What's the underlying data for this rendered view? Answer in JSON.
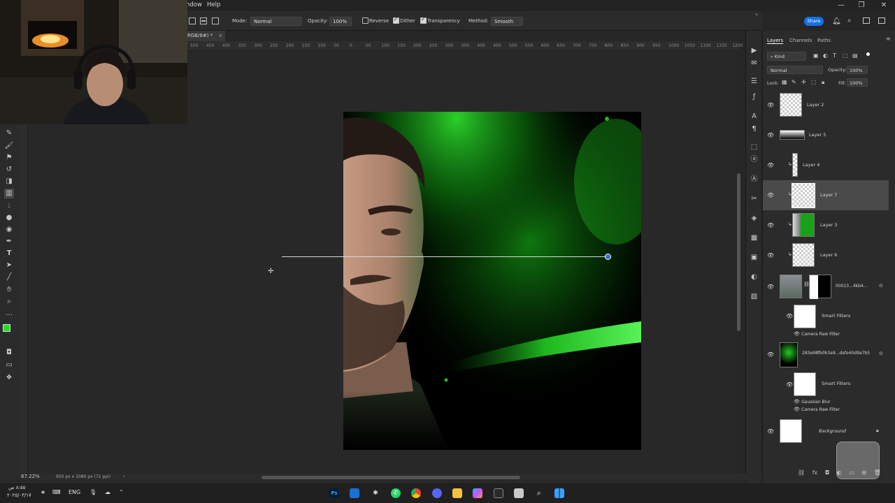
{
  "menu": {
    "window": "ndow",
    "help": "Help"
  },
  "window_controls": {
    "minimize": "—",
    "restore": "❐",
    "close": "✕"
  },
  "options": {
    "mode_label": "Mode:",
    "mode_value": "Normal",
    "opacity_label": "Opacity:",
    "opacity_value": "100%",
    "reverse_label": "Reverse",
    "dither_label": "Dither",
    "transparency_label": "Transparency",
    "method_label": "Method:",
    "method_value": "Smooth",
    "share_label": "Share"
  },
  "document_tab": {
    "title": "RGB/8#) *",
    "close": "×"
  },
  "ruler_ticks": [
    "500",
    "450",
    "400",
    "350",
    "300",
    "250",
    "200",
    "150",
    "100",
    "50",
    "0",
    "50",
    "100",
    "150",
    "200",
    "250",
    "300",
    "350",
    "400",
    "450",
    "500",
    "550",
    "600",
    "650",
    "700",
    "750",
    "800",
    "850",
    "900",
    "950",
    "1000",
    "1050",
    "1100",
    "1150",
    "1200",
    "1250"
  ],
  "status": {
    "zoom": "67.22%",
    "doc_info": "950 px x 1080 px (72 ppi)",
    "arrow": "›"
  },
  "panel": {
    "tabs": [
      "Layers",
      "Channels",
      "Paths"
    ],
    "filter_label": "Kind",
    "blend_mode": "Normal",
    "opacity_label": "Opacity:",
    "opacity_value": "100%",
    "lock_label": "Lock:",
    "fill_label": "Fill:",
    "fill_value": "100%"
  },
  "layers": [
    {
      "name": "Layer 2"
    },
    {
      "name": "Layer 5"
    },
    {
      "name": "Layer 4"
    },
    {
      "name": "Layer 7"
    },
    {
      "name": "Layer 3"
    },
    {
      "name": "Layer 6"
    },
    {
      "name": "00013...4kb4...",
      "sub": [
        {
          "name": "Smart Filters"
        },
        {
          "name": "Camera Raw Filter"
        }
      ]
    },
    {
      "name": "283e98fb0b3a9...dafe40d9a7b5",
      "sub": [
        {
          "name": "Smart Filters"
        },
        {
          "name": "Gaussian Blur"
        },
        {
          "name": "Camera Raw Filter"
        }
      ]
    },
    {
      "name": "Background"
    }
  ],
  "panel_footer_icons": [
    "link-icon",
    "fx-icon",
    "mask-icon",
    "adjustment-icon",
    "folder-icon",
    "new-layer-icon",
    "trash-icon"
  ],
  "taskbar": {
    "lang": "ENG",
    "clock_top": "٨:٥٥ ص",
    "clock_bottom": "٢٠٢٥/٠٣/١٧",
    "apps": [
      "photoshop",
      "explorer-window",
      "chatgpt",
      "whatsapp",
      "chrome",
      "discord",
      "files",
      "copilot",
      "store",
      "notepad",
      "search",
      "windows"
    ]
  },
  "colors": {
    "accent": "#1473e6",
    "foreground": "#22dd22",
    "background": "#1aa51a",
    "glow": "#2bff2b"
  }
}
